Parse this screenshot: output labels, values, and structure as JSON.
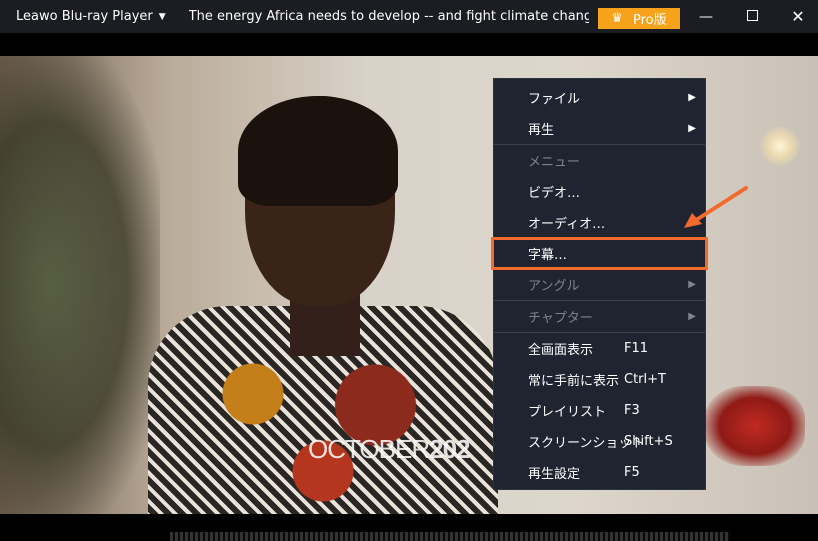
{
  "titlebar": {
    "app_name": "Leawo Blu-ray Player",
    "video_title": "The energy Africa needs to develop -- and fight climate change  Rose",
    "pro_label": "Pro版",
    "accent": "#f7a21b"
  },
  "window_controls": {
    "minimize_icon": "minimize-icon",
    "maximize_icon": "maximize-icon",
    "close_icon": "close-icon"
  },
  "video": {
    "watermark_thin": "OCTOBER",
    "watermark_bold": "202"
  },
  "menu": {
    "items": [
      {
        "label": "ファイル",
        "shortcut": "",
        "submenu": true,
        "disabled": false
      },
      {
        "label": "再生",
        "shortcut": "",
        "submenu": true,
        "disabled": false
      },
      {
        "label": "メニュー",
        "shortcut": "",
        "submenu": false,
        "disabled": true
      },
      {
        "label": "ビデオ…",
        "shortcut": "",
        "submenu": false,
        "disabled": false
      },
      {
        "label": "オーディオ…",
        "shortcut": "",
        "submenu": false,
        "disabled": false
      },
      {
        "label": "字幕…",
        "shortcut": "",
        "submenu": false,
        "disabled": false,
        "highlighted": true
      },
      {
        "label": "アングル",
        "shortcut": "",
        "submenu": true,
        "disabled": true
      },
      {
        "label": "チャプター",
        "shortcut": "",
        "submenu": true,
        "disabled": true
      },
      {
        "label": "全画面表示",
        "shortcut": "F11",
        "submenu": false,
        "disabled": false
      },
      {
        "label": "常に手前に表示",
        "shortcut": "Ctrl+T",
        "submenu": false,
        "disabled": false
      },
      {
        "label": "プレイリスト",
        "shortcut": "F3",
        "submenu": false,
        "disabled": false
      },
      {
        "label": "スクリーンショット",
        "shortcut": "Shift+S",
        "submenu": false,
        "disabled": false
      },
      {
        "label": "再生設定",
        "shortcut": "F5",
        "submenu": false,
        "disabled": false
      }
    ],
    "highlight_color": "#f26a2e"
  }
}
